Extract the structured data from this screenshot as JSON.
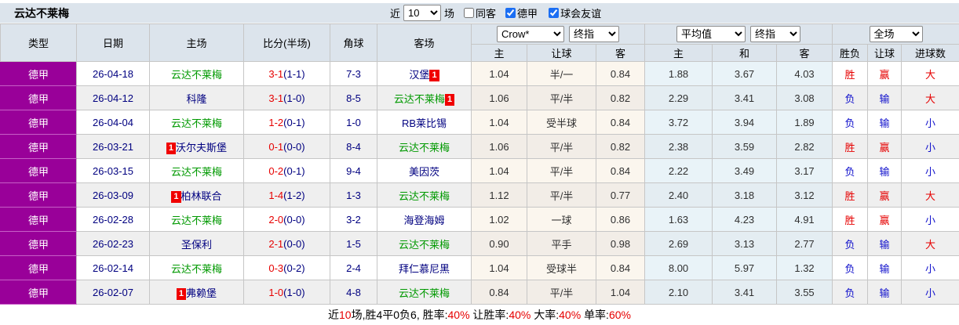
{
  "header": {
    "team": "云达不莱梅",
    "near_label": "近",
    "games_count": "10",
    "games_label": "场",
    "checkboxes": [
      {
        "label": "同客",
        "checked": false
      },
      {
        "label": "德甲",
        "checked": true
      },
      {
        "label": "球会友谊",
        "checked": true
      }
    ]
  },
  "selects": {
    "company": "Crow*",
    "company_stage": "终指",
    "average": "平均值",
    "average_stage": "终指",
    "scope": "全场"
  },
  "columns": {
    "main": [
      "类型",
      "日期",
      "主场",
      "比分(半场)",
      "角球",
      "客场"
    ],
    "odds_sub": [
      "主",
      "让球",
      "客"
    ],
    "avg_sub": [
      "主",
      "和",
      "客"
    ],
    "result_sub": [
      "胜负",
      "让球",
      "进球数"
    ]
  },
  "rows": [
    {
      "type": "德甲",
      "date": "26-04-18",
      "home": "云达不莱梅",
      "home_badge": null,
      "score": "3-1",
      "half": "(1-1)",
      "corner": "7-3",
      "away": "汉堡",
      "away_badge": "1",
      "odds": [
        "1.04",
        "半/一",
        "0.84"
      ],
      "avg": [
        "1.88",
        "3.67",
        "4.03"
      ],
      "result": [
        "胜",
        "赢",
        "大"
      ]
    },
    {
      "type": "德甲",
      "date": "26-04-12",
      "home": "科隆",
      "home_badge": null,
      "score": "3-1",
      "half": "(1-0)",
      "corner": "8-5",
      "away": "云达不莱梅",
      "away_badge": "1",
      "odds": [
        "1.06",
        "平/半",
        "0.82"
      ],
      "avg": [
        "2.29",
        "3.41",
        "3.08"
      ],
      "result": [
        "负",
        "输",
        "大"
      ]
    },
    {
      "type": "德甲",
      "date": "26-04-04",
      "home": "云达不莱梅",
      "home_badge": null,
      "score": "1-2",
      "half": "(0-1)",
      "corner": "1-0",
      "away": "RB莱比锡",
      "away_badge": null,
      "odds": [
        "1.04",
        "受半球",
        "0.84"
      ],
      "avg": [
        "3.72",
        "3.94",
        "1.89"
      ],
      "result": [
        "负",
        "输",
        "小"
      ]
    },
    {
      "type": "德甲",
      "date": "26-03-21",
      "home": "沃尔夫斯堡",
      "home_badge": "1",
      "score": "0-1",
      "half": "(0-0)",
      "corner": "8-4",
      "away": "云达不莱梅",
      "away_badge": null,
      "odds": [
        "1.06",
        "平/半",
        "0.82"
      ],
      "avg": [
        "2.38",
        "3.59",
        "2.82"
      ],
      "result": [
        "胜",
        "赢",
        "小"
      ]
    },
    {
      "type": "德甲",
      "date": "26-03-15",
      "home": "云达不莱梅",
      "home_badge": null,
      "score": "0-2",
      "half": "(0-1)",
      "corner": "9-4",
      "away": "美因茨",
      "away_badge": null,
      "odds": [
        "1.04",
        "平/半",
        "0.84"
      ],
      "avg": [
        "2.22",
        "3.49",
        "3.17"
      ],
      "result": [
        "负",
        "输",
        "小"
      ]
    },
    {
      "type": "德甲",
      "date": "26-03-09",
      "home": "柏林联合",
      "home_badge": "1",
      "score": "1-4",
      "half": "(1-2)",
      "corner": "1-3",
      "away": "云达不莱梅",
      "away_badge": null,
      "odds": [
        "1.12",
        "平/半",
        "0.77"
      ],
      "avg": [
        "2.40",
        "3.18",
        "3.12"
      ],
      "result": [
        "胜",
        "赢",
        "大"
      ]
    },
    {
      "type": "德甲",
      "date": "26-02-28",
      "home": "云达不莱梅",
      "home_badge": null,
      "score": "2-0",
      "half": "(0-0)",
      "corner": "3-2",
      "away": "海登海姆",
      "away_badge": null,
      "odds": [
        "1.02",
        "一球",
        "0.86"
      ],
      "avg": [
        "1.63",
        "4.23",
        "4.91"
      ],
      "result": [
        "胜",
        "赢",
        "小"
      ]
    },
    {
      "type": "德甲",
      "date": "26-02-23",
      "home": "圣保利",
      "home_badge": null,
      "score": "2-1",
      "half": "(0-0)",
      "corner": "1-5",
      "away": "云达不莱梅",
      "away_badge": null,
      "odds": [
        "0.90",
        "平手",
        "0.98"
      ],
      "avg": [
        "2.69",
        "3.13",
        "2.77"
      ],
      "result": [
        "负",
        "输",
        "大"
      ]
    },
    {
      "type": "德甲",
      "date": "26-02-14",
      "home": "云达不莱梅",
      "home_badge": null,
      "score": "0-3",
      "half": "(0-2)",
      "corner": "2-4",
      "away": "拜仁慕尼黑",
      "away_badge": null,
      "odds": [
        "1.04",
        "受球半",
        "0.84"
      ],
      "avg": [
        "8.00",
        "5.97",
        "1.32"
      ],
      "result": [
        "负",
        "输",
        "小"
      ]
    },
    {
      "type": "德甲",
      "date": "26-02-07",
      "home": "弗赖堡",
      "home_badge": "1",
      "score": "1-0",
      "half": "(1-0)",
      "corner": "4-8",
      "away": "云达不莱梅",
      "away_badge": null,
      "odds": [
        "0.84",
        "平/半",
        "1.04"
      ],
      "avg": [
        "2.10",
        "3.41",
        "3.55"
      ],
      "result": [
        "负",
        "输",
        "小"
      ]
    }
  ],
  "result_red_values": [
    "胜",
    "赢",
    "大"
  ],
  "footer": {
    "segments": [
      {
        "t": "近",
        "red": false
      },
      {
        "t": "10",
        "red": true
      },
      {
        "t": "场,胜4平0负6, 胜率:",
        "red": false
      },
      {
        "t": "40%",
        "red": true
      },
      {
        "t": " 让胜率:",
        "red": false
      },
      {
        "t": "40%",
        "red": true
      },
      {
        "t": " 大率:",
        "red": false
      },
      {
        "t": "40%",
        "red": true
      },
      {
        "t": " 单率:",
        "red": false
      },
      {
        "t": "60%",
        "red": true
      }
    ]
  },
  "colors": {
    "header-bg": "#dce4ec",
    "purple": "#990099",
    "green": "#009900",
    "red": "#e60000",
    "blue": "#1111cc",
    "navy": "#000080",
    "row-alt": "#efefef",
    "tint-cream": "#fbf6ee",
    "tint-blue": "#e9f3f8",
    "badge-red": "#f00000"
  }
}
